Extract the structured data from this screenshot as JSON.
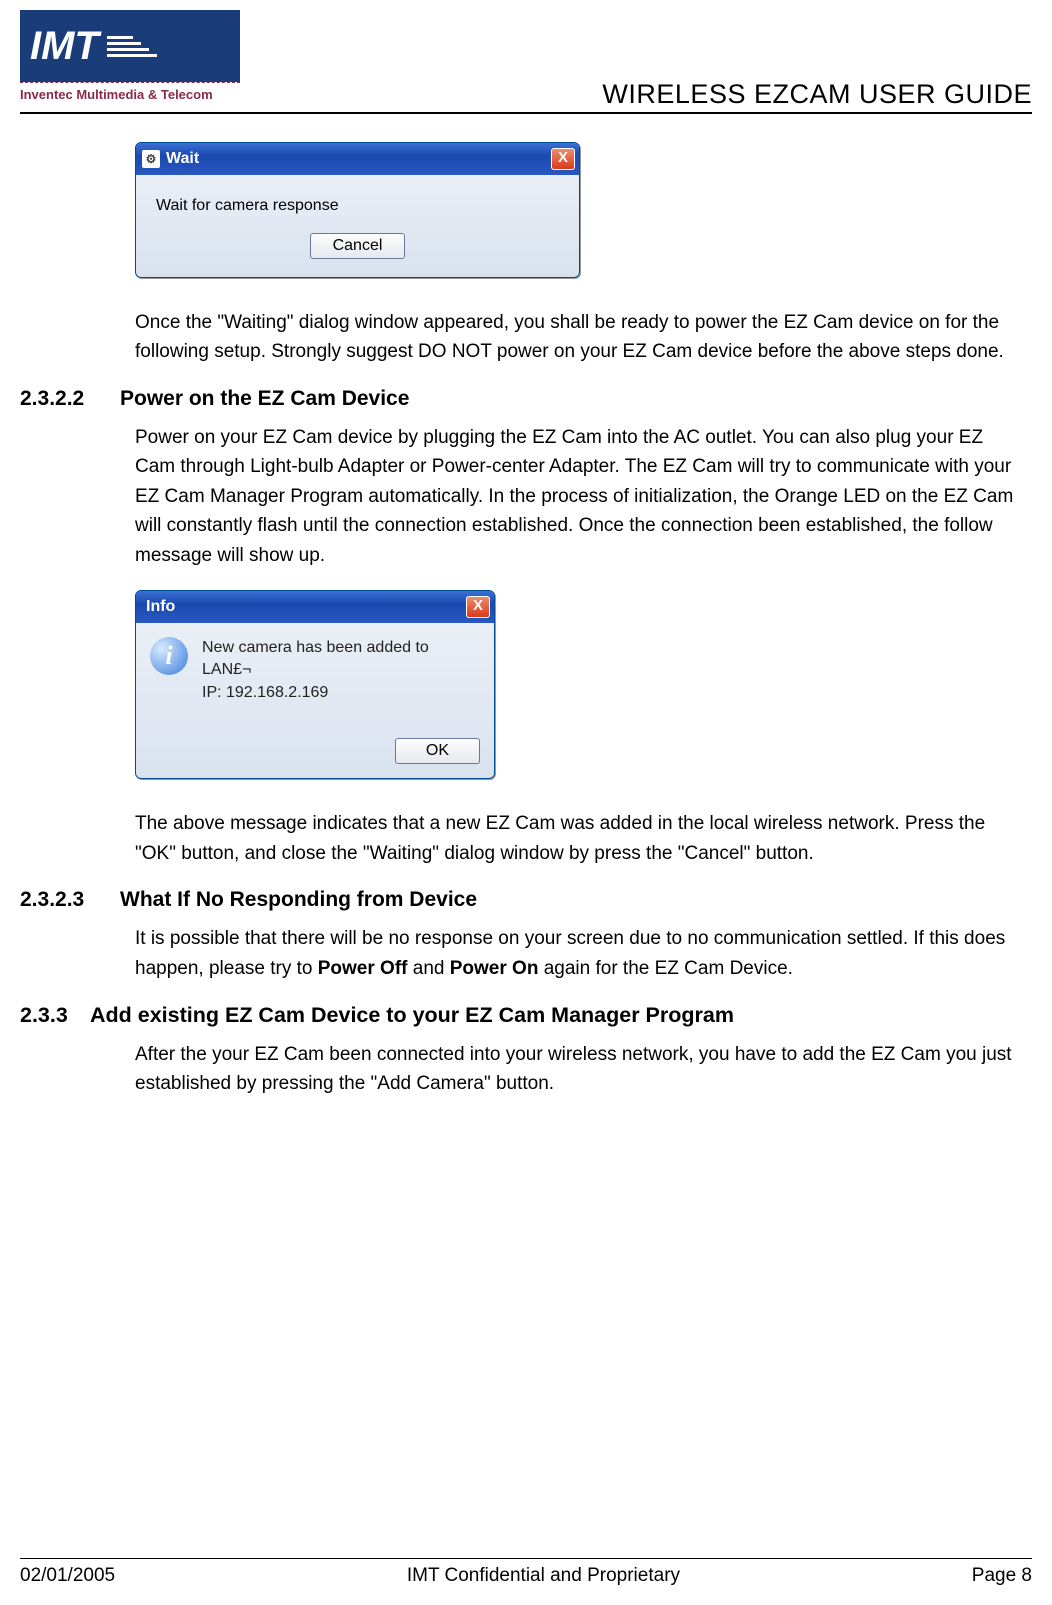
{
  "header": {
    "logo_text": "IMT",
    "logo_sub": "Inventec Multimedia & Telecom",
    "doc_title": "WIRELESS EZCAM USER GUIDE"
  },
  "dialog_wait": {
    "title": "Wait",
    "icon_glyph": "⚙",
    "close_glyph": "X",
    "message": "Wait for camera response",
    "button": "Cancel"
  },
  "para_wait_after": "Once the \"Waiting\" dialog window appeared, you shall be ready to power the EZ Cam device on for the following setup.  Strongly suggest DO NOT power on your EZ Cam device before the above steps done.",
  "sec_power": {
    "num": "2.3.2.2",
    "title": "Power on the EZ Cam Device",
    "para": "Power on your EZ Cam device by plugging the EZ Cam into the AC outlet.  You can also plug your EZ Cam through Light-bulb Adapter or Power-center Adapter.  The EZ Cam will try to communicate with your EZ Cam Manager Program automatically.  In the process of initialization, the Orange LED on the EZ Cam will constantly flash until the connection established.  Once the connection been established, the follow message will show up."
  },
  "dialog_info": {
    "title": "Info",
    "close_glyph": "X",
    "icon_glyph": "i",
    "line1": "New camera has been added to LAN£¬",
    "line2": "IP: 192.168.2.169",
    "button": "OK"
  },
  "para_info_after": "The above message indicates that a new EZ Cam was added in the local wireless network.  Press the \"OK\" button, and close the \"Waiting\" dialog window by press the \"Cancel\" button.",
  "sec_noresp": {
    "num": "2.3.2.3",
    "title": "What If No Responding from Device",
    "para_pre": "It is possible that there will be no response on your screen due to no communication settled.  If this does happen, please try to ",
    "bold1": "Power Off",
    "mid": " and ",
    "bold2": "Power On",
    "para_post": " again for the EZ Cam Device."
  },
  "sec_add": {
    "num": "2.3.3",
    "title": "Add existing EZ Cam Device to your EZ Cam Manager Program",
    "para": "After the your EZ Cam been connected into your wireless network, you have to add the EZ Cam you just established by pressing the \"Add Camera\" button."
  },
  "footer": {
    "date": "02/01/2005",
    "center": "IMT Confidential and Proprietary",
    "page": "Page 8"
  }
}
